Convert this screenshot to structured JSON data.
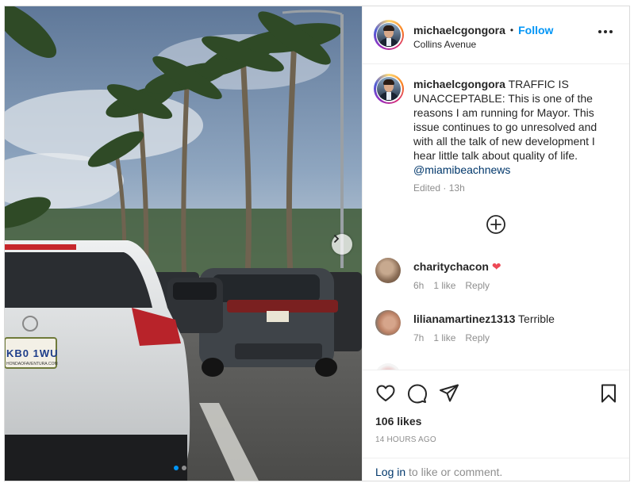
{
  "post": {
    "username": "michaelcgongora",
    "separator": "•",
    "follow_label": "Follow",
    "location": "Collins Avenue",
    "more_icon": "more-horizontal-icon",
    "caption_text": "TRAFFIC IS UNACCEPTABLE: This is one of the reasons I am running for Mayor. This issue continues to go unresolved and with all the talk of new development I hear little talk about quality of life.",
    "caption_mention": "@miamibeachnews",
    "edited_label": "Edited",
    "edited_dot": "·",
    "edited_time": "13h",
    "load_more_icon": "plus-circle-icon"
  },
  "photo": {
    "plate_text": "KB0 1WU",
    "plate_dealer": "HONDAOFAVENTURA.COM",
    "carousel_next_icon": "chevron-right-icon"
  },
  "comments": [
    {
      "username": "charitychacon",
      "text": "",
      "emoji": "❤",
      "time": "6h",
      "likes": "1 like",
      "reply": "Reply"
    },
    {
      "username": "lilianamartinez1313",
      "text": "Terrible",
      "emoji": "",
      "time": "7h",
      "likes": "1 like",
      "reply": "Reply"
    }
  ],
  "actions": {
    "like_icon": "heart-icon",
    "comment_icon": "comment-icon",
    "share_icon": "send-icon",
    "save_icon": "bookmark-icon",
    "likes_count": "106 likes",
    "timestamp": "14 HOURS AGO"
  },
  "login": {
    "link": "Log in",
    "rest": " to like or comment."
  },
  "colors": {
    "accent": "#0095f6",
    "heart": "#ed4956",
    "text": "#262626",
    "muted": "#8e8e8e",
    "link_dark": "#00376b"
  }
}
